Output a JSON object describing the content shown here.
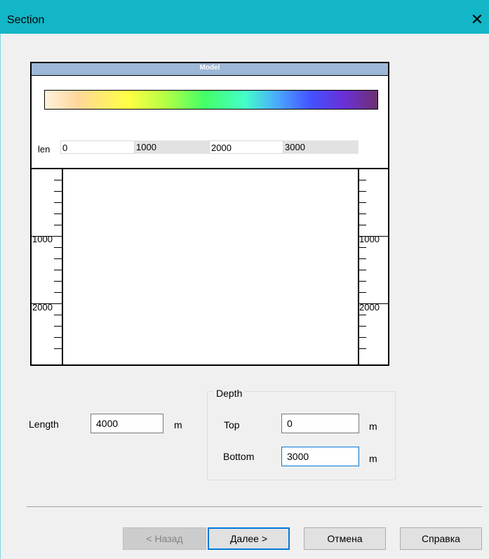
{
  "window": {
    "title": "Section",
    "close_glyph": "✕"
  },
  "model": {
    "title": "Model",
    "len_label": "len",
    "len_ticks": [
      "0",
      "1000",
      "2000",
      "3000"
    ],
    "depth_ticks_left": [
      "1000",
      "2000"
    ],
    "depth_ticks_right": [
      "1000",
      "2000"
    ],
    "colorscale": [
      "#fff1dd",
      "#ffd79a",
      "#ffff44",
      "#b5ff44",
      "#44ff66",
      "#44ffc8",
      "#4aa8ff",
      "#4451ff",
      "#6a2fd6",
      "#6d3171"
    ]
  },
  "form": {
    "length_label": "Length",
    "length_value": "4000",
    "length_unit": "m",
    "depth_group_label": "Depth",
    "top_label": "Top",
    "top_value": "0",
    "top_unit": "m",
    "bottom_label": "Bottom",
    "bottom_value": "3000",
    "bottom_unit": "m"
  },
  "buttons": {
    "back": "< Назад",
    "next": "Далее >",
    "cancel": "Отмена",
    "help": "Справка"
  }
}
